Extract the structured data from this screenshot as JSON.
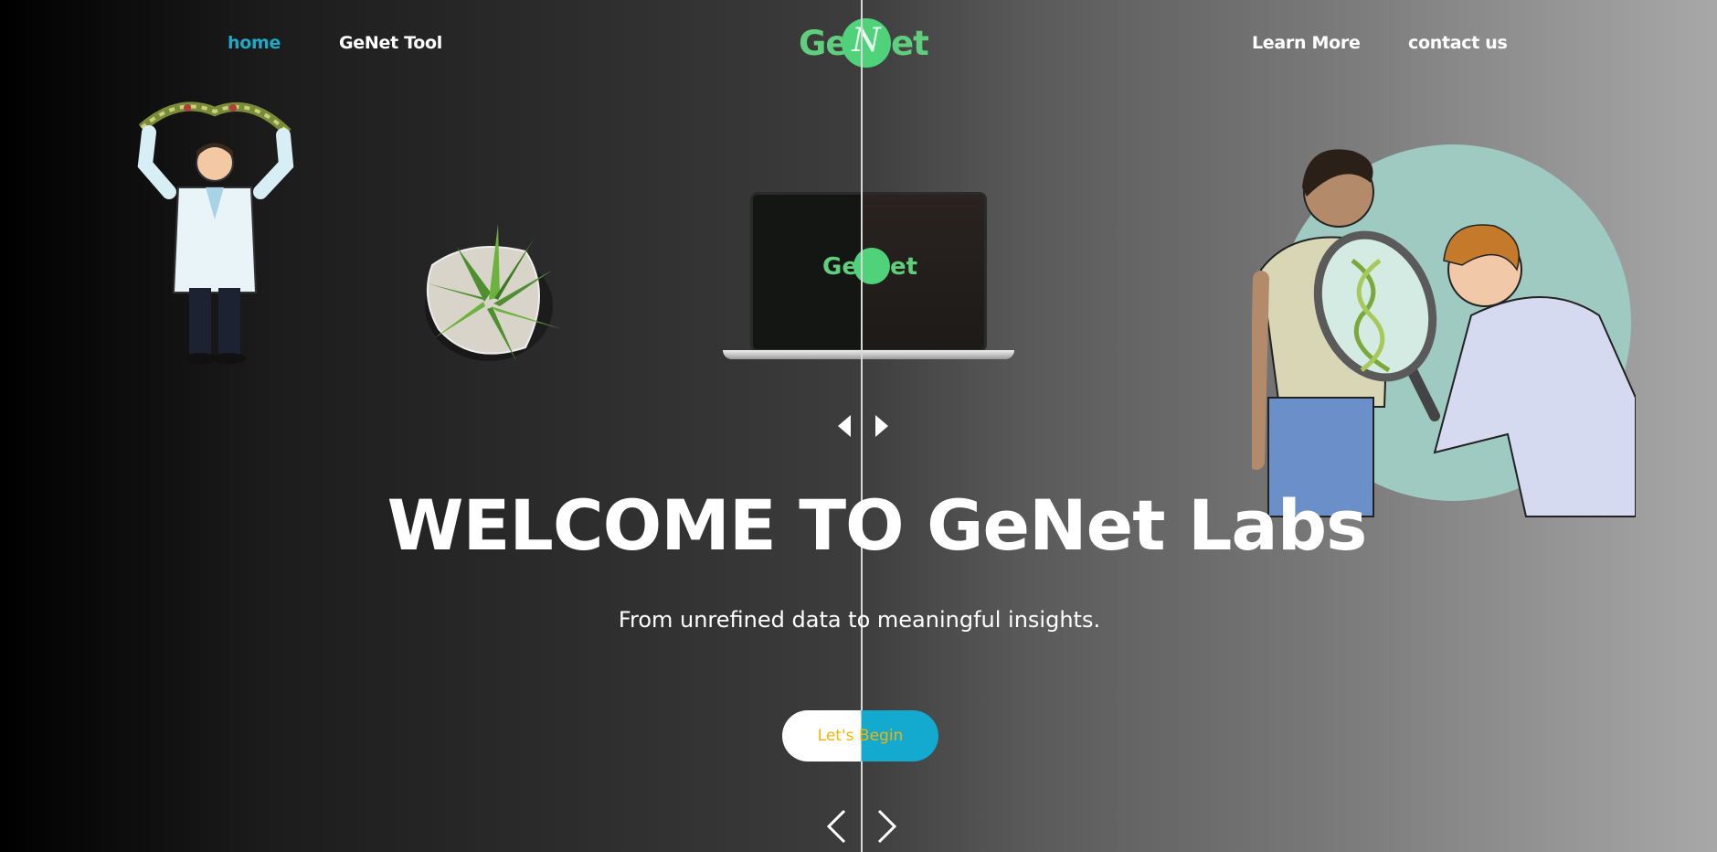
{
  "nav": {
    "home": "home",
    "genet_tool": "GeNet Tool",
    "learn_more": "Learn More",
    "contact_us": "contact us"
  },
  "logo": {
    "left": "Ge",
    "mid": "N",
    "right": "et"
  },
  "hero": {
    "title": "WELCOME TO GeNet Labs",
    "subtitle": "From unrefined data to meaningful insights.",
    "cta": "Let's Begin"
  },
  "colors": {
    "accent": "#1ea9c8",
    "brand_green": "#4fd27a",
    "cta_text": "#f6b400"
  },
  "icons": [
    "scientist-holding-dna-illustration",
    "plant-pot-image",
    "laptop-mockup-image",
    "scientists-magnifier-illustration",
    "triangle-left-icon",
    "triangle-right-icon",
    "chevron-left-icon",
    "chevron-right-icon"
  ]
}
